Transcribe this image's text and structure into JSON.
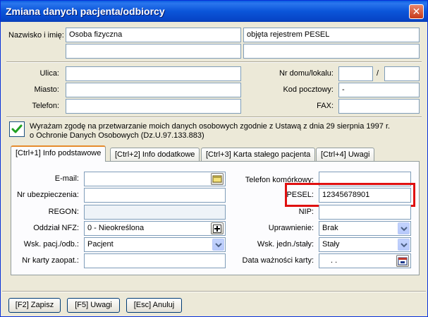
{
  "window": {
    "title": "Zmiana danych pacjenta/odbiorcy"
  },
  "name_section": {
    "label": "Nazwisko i imię:",
    "field1": "Osoba fizyczna",
    "field2": "objęta rejestrem PESEL",
    "field3": "",
    "field4": ""
  },
  "address": {
    "street_label": "Ulica:",
    "street": "",
    "house_label": "Nr domu/lokalu:",
    "house": "",
    "slash": "/",
    "flat": "",
    "city_label": "Miasto:",
    "city": "",
    "postal_label": "Kod pocztowy:",
    "postal": "-",
    "phone_label": "Telefon:",
    "phone": "",
    "fax_label": "FAX:",
    "fax": ""
  },
  "consent": {
    "checked": true,
    "line1": "Wyrażam zgodę na przetwarzanie moich danych osobowych zgodnie z Ustawą z dnia 29 sierpnia 1997 r.",
    "line2": "o Ochronie Danych Osobowych (Dz.U.97.133.883)"
  },
  "tabs": [
    {
      "label": "[Ctrl+1] Info podstawowe",
      "active": true
    },
    {
      "label": "[Ctrl+2] Info dodatkowe",
      "active": false
    },
    {
      "label": "[Ctrl+3] Karta stałego pacjenta",
      "active": false
    },
    {
      "label": "[Ctrl+4] Uwagi",
      "active": false
    }
  ],
  "info": {
    "email_label": "E-mail:",
    "email": "",
    "insurance_label": "Nr ubezpieczenia:",
    "insurance": "",
    "regon_label": "REGON:",
    "regon": "",
    "nfz_label": "Oddział NFZ:",
    "nfz": "0 - Nieokreślona",
    "wsk_label": "Wsk. pacj./odb.:",
    "wsk": "Pacjent",
    "card_label": "Nr karty zaopat.:",
    "card": "",
    "mobile_label": "Telefon komórkowy:",
    "mobile": "",
    "pesel_label": "PESEL:",
    "pesel": "12345678901",
    "nip_label": "NIP:",
    "nip": "",
    "rights_label": "Uprawnienie:",
    "rights": "Brak",
    "wsk_unit_label": "Wsk. jedn./stały:",
    "wsk_unit": "Stały",
    "validity_label": "Data ważności karty:",
    "validity": ". ."
  },
  "buttons": {
    "save": "[F2] Zapisz",
    "notes": "[F5] Uwagi",
    "cancel": "[Esc] Anuluj"
  },
  "colors": {
    "title_bar": "#0b55d9",
    "highlight": "#e01010",
    "active_tab_accent": "#e68b2c"
  }
}
